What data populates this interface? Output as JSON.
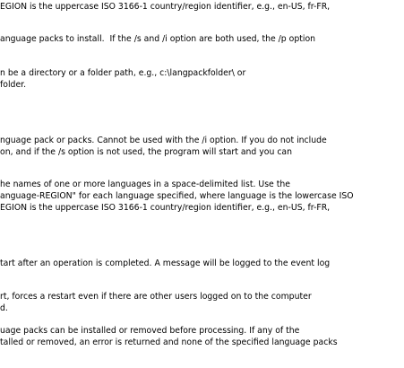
{
  "help_text": {
    "lines": [
      "EGION is the uppercase ISO 3166-1 country/region identifier, e.g., en-US, fr-FR,",
      "anguage packs to install.  If the /s and /i option are both used, the /p option",
      "n be a directory or a folder path, e.g., c:\\langpackfolder\\ or",
      "folder.",
      "nguage pack or packs. Cannot be used with the /i option. If you do not include",
      "on, and if the /s option is not used, the program will start and you can",
      "he names of one or more languages in a space-delimited list. Use the",
      "anguage-REGION\" for each language specified, where language is the lowercase ISO",
      "EGION is the uppercase ISO 3166-1 country/region identifier, e.g., en-US, fr-FR,",
      "tart after an operation is completed. A message will be logged to the event log",
      "rt, forces a restart even if there are other users logged on to the computer",
      "d.",
      "uage packs can be installed or removed before processing. If any of the",
      "talled or removed, an error is returned and none of the specified language packs"
    ]
  }
}
